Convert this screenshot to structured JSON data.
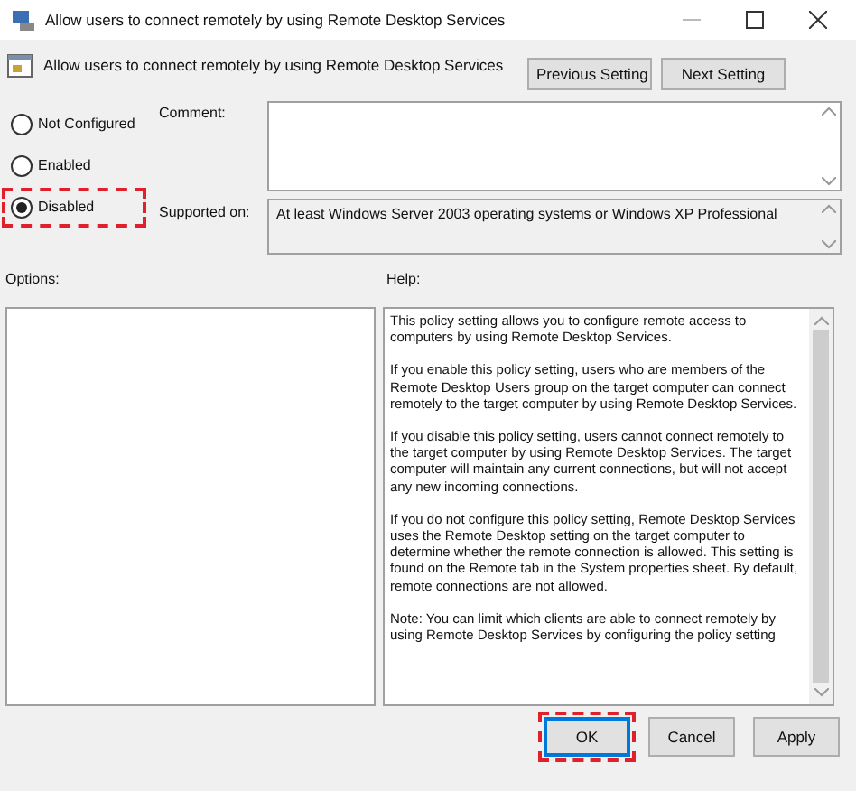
{
  "window": {
    "title": "Allow users to connect remotely by using Remote Desktop Services"
  },
  "header": {
    "policy_name": "Allow users to connect remotely by using Remote Desktop Services",
    "buttons": [
      "Previous Setting",
      "Next Setting"
    ]
  },
  "options": [
    {
      "label": "Not Configured",
      "selected": false,
      "highlighted": false
    },
    {
      "label": "Enabled",
      "selected": false,
      "highlighted": false
    },
    {
      "label": "Disabled",
      "selected": true,
      "highlighted": true
    }
  ],
  "comment": {
    "label": "Comment:"
  },
  "supported_on": {
    "label": "Supported on:",
    "value": "At least Windows Server 2003 operating systems or Windows XP Professional"
  },
  "options_panel": {
    "label": "Options:"
  },
  "help": {
    "label": "Help:",
    "paragraphs": [
      "This policy setting allows you to configure remote access to computers by using Remote Desktop Services.",
      "If you enable this policy setting, users who are members of the Remote Desktop Users group on the target computer can connect remotely to the target computer by using Remote Desktop Services.",
      "If you disable this policy setting, users cannot connect remotely to the target computer by using Remote Desktop Services. The target computer will maintain any current connections, but will not accept any new incoming connections.",
      "If you do not configure this policy setting, Remote Desktop Services uses the Remote Desktop setting on the target computer to determine whether the remote connection is allowed. This setting is found on the Remote tab in the System properties sheet. By default, remote connections are not allowed.",
      "Note: You can limit which clients are able to connect remotely by using Remote Desktop Services by configuring the policy setting"
    ]
  },
  "footer_buttons": [
    {
      "label": "OK",
      "highlighted": true
    },
    {
      "label": "Cancel",
      "highlighted": false
    },
    {
      "label": "Apply",
      "highlighted": false
    }
  ]
}
